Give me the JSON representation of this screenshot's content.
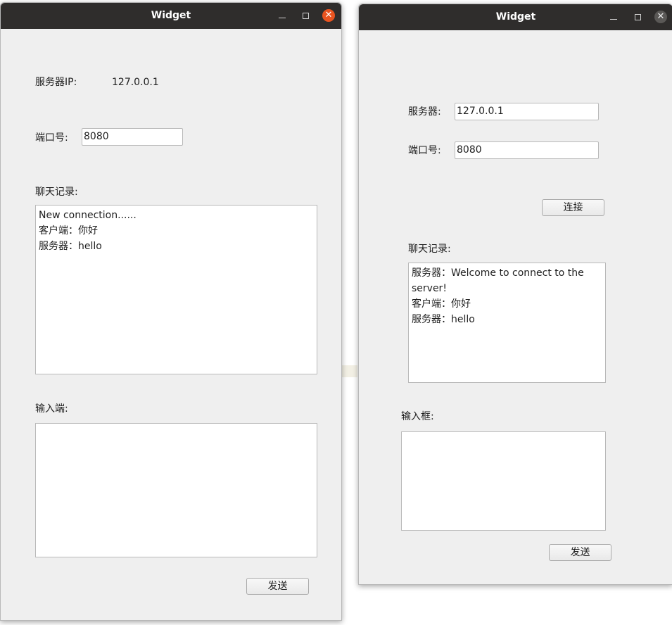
{
  "server_window": {
    "title": "Widget",
    "ip_label": "服务器IP:",
    "ip_value": "127.0.0.1",
    "port_label": "端口号:",
    "port_value": "8080",
    "chat_label": "聊天记录:",
    "chat_lines": [
      "New connection......",
      "客户端：你好",
      "服务器：hello"
    ],
    "input_label": "输入端:",
    "input_value": "",
    "send_label": "发送"
  },
  "client_window": {
    "title": "Widget",
    "server_label": "服务器:",
    "server_value": "127.0.0.1",
    "port_label": "端口号:",
    "port_value": "8080",
    "connect_label": "连接",
    "chat_label": "聊天记录:",
    "chat_lines": [
      "服务器：Welcome to connect to the",
      "server!",
      "客户端：你好",
      "服务器：hello"
    ],
    "input_label": "输入框:",
    "input_value": "",
    "send_label": "发送"
  },
  "icons": {
    "minimize": "minimize-icon",
    "maximize": "maximize-icon",
    "close": "close-icon",
    "close_glyph": "✕"
  },
  "colors": {
    "titlebar": "#2f2d2c",
    "window_bg": "#efefef",
    "close_active": "#e95420",
    "close_inactive": "#5a5856"
  }
}
